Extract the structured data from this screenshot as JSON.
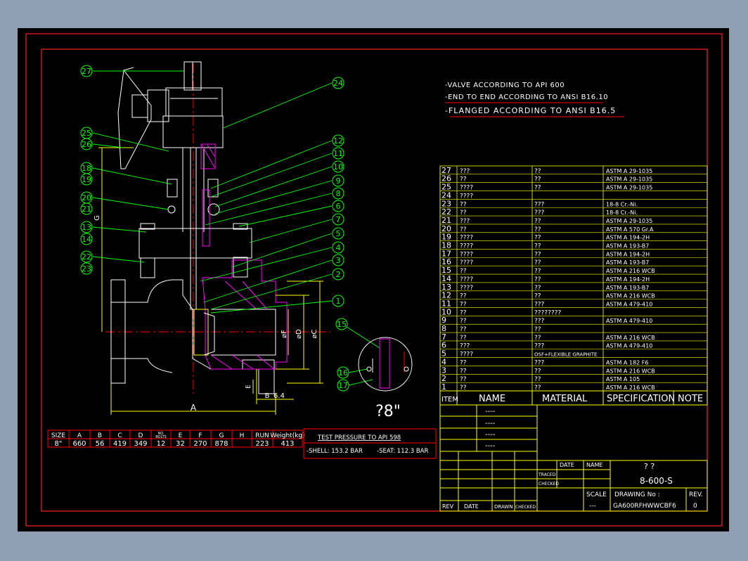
{
  "notes": [
    "-VALVE ACCORDING TO API 600",
    "-END TO END ACCORDING TO ANSI B16.10",
    "-FLANGED ACCORDING TO ANSI B16.5"
  ],
  "balloons_left": [
    "27",
    "25",
    "26",
    "18",
    "19",
    "20",
    "21",
    "13",
    "14",
    "22",
    "23"
  ],
  "balloons_right": [
    "24",
    "12",
    "11",
    "10",
    "9",
    "8",
    "6",
    "7",
    "5",
    "4",
    "3",
    "2",
    "1"
  ],
  "balloons_detail": [
    "15",
    "16",
    "17"
  ],
  "dim_labels": {
    "A": "A",
    "B": "B",
    "C": "⌀C",
    "D": "⌀D",
    "F": "⌀F",
    "E": "E",
    "G": "G",
    "dim64": "6.4",
    "size_mark": "?8\""
  },
  "dim_table": {
    "headers": [
      "SIZE",
      "A",
      "B",
      "C",
      "D",
      "NO.\nBOLTS",
      "E",
      "F",
      "G",
      "H",
      "RUN",
      "Weight(kg)"
    ],
    "row": [
      "8\"",
      "660",
      "56",
      "419",
      "349",
      "12",
      "32",
      "270",
      "878",
      "",
      "223",
      "413"
    ]
  },
  "test_pressure": {
    "title": "TEST PRESSURE TO API 598",
    "shell": "-SHELL: 153.2  BAR",
    "seat": "-SEAT: 112.3  BAR"
  },
  "bom": [
    [
      "27",
      "???",
      "??",
      "ASTM A 29-1035"
    ],
    [
      "26",
      "??",
      "??",
      "ASTM A 29-1035"
    ],
    [
      "25",
      "????",
      "??",
      "ASTM A 29-1035"
    ],
    [
      "24",
      "????",
      "",
      ""
    ],
    [
      "23",
      "??",
      "???",
      "18-8 Cr.-Ni."
    ],
    [
      "22",
      "??",
      "???",
      "18-8 Cr.-Ni."
    ],
    [
      "21",
      "???",
      "??",
      "ASTM A 29-1035"
    ],
    [
      "20",
      "??",
      "??",
      "ASTM A 570 Gr.A"
    ],
    [
      "19",
      "????",
      "??",
      "ASTM A 194-2H"
    ],
    [
      "18",
      "????",
      "??",
      "ASTM A 193-B7"
    ],
    [
      "17",
      "????",
      "??",
      "ASTM A 194-2H"
    ],
    [
      "16",
      "????",
      "??",
      "ASTM A 193-B7"
    ],
    [
      "15",
      "??",
      "??",
      "ASTM A 216 WCB"
    ],
    [
      "14",
      "????",
      "??",
      "ASTM A 194-2H"
    ],
    [
      "13",
      "????",
      "??",
      "ASTM A 193-B7"
    ],
    [
      "12",
      "??",
      "??",
      "ASTM A 216 WCB"
    ],
    [
      "11",
      "??",
      "???",
      "ASTM A 479-410"
    ],
    [
      "10",
      "??",
      "????????",
      ""
    ],
    [
      "9",
      "??",
      "???",
      "ASTM A 479-410"
    ],
    [
      "8",
      "??",
      "??",
      ""
    ],
    [
      "7",
      "??",
      "??",
      "ASTM A 216 WCB"
    ],
    [
      "6",
      "???",
      "???",
      "ASTM A 479-410"
    ],
    [
      "5",
      "????",
      "OSF+FLEXIBLE GRAPHITE",
      ""
    ],
    [
      "4",
      "??",
      "???",
      "ASTM A 182 F6"
    ],
    [
      "3",
      "??",
      "??",
      "ASTM A 216 WCB"
    ],
    [
      "2",
      "??",
      "??",
      "ASTM A 105"
    ],
    [
      "1",
      "??",
      "??",
      "ASTM A 216 WCB"
    ]
  ],
  "bom_header": [
    "ITEM",
    "NAME",
    "MATERIAL",
    "SPECIFICATION",
    "NOTE"
  ],
  "revisions": [
    "----",
    "----",
    "----",
    "----"
  ],
  "title_block": {
    "date_label": "DATE",
    "name_label": "NAME",
    "traced": "TRACED",
    "checked": "CHECKED",
    "title_q": "?   ?",
    "model": "8-600-S",
    "scale_label": "SCALE",
    "scale_value": "---",
    "drawing_no_label": "DRAWING No :",
    "drawing_no": "GA600RFHWWCBF6",
    "rev_label": "REV.",
    "rev_value": "0",
    "rev_cols": [
      "REV",
      "DATE",
      "DRAWN",
      "CHECKED"
    ]
  },
  "colors": {
    "bg": "#000000",
    "frame": "#ff2020",
    "white": "#ffffff",
    "green": "#00ff00",
    "yellow": "#ffff00",
    "magenta": "#ff00ff",
    "red": "#ff0000",
    "cyan": "#00ffff"
  }
}
